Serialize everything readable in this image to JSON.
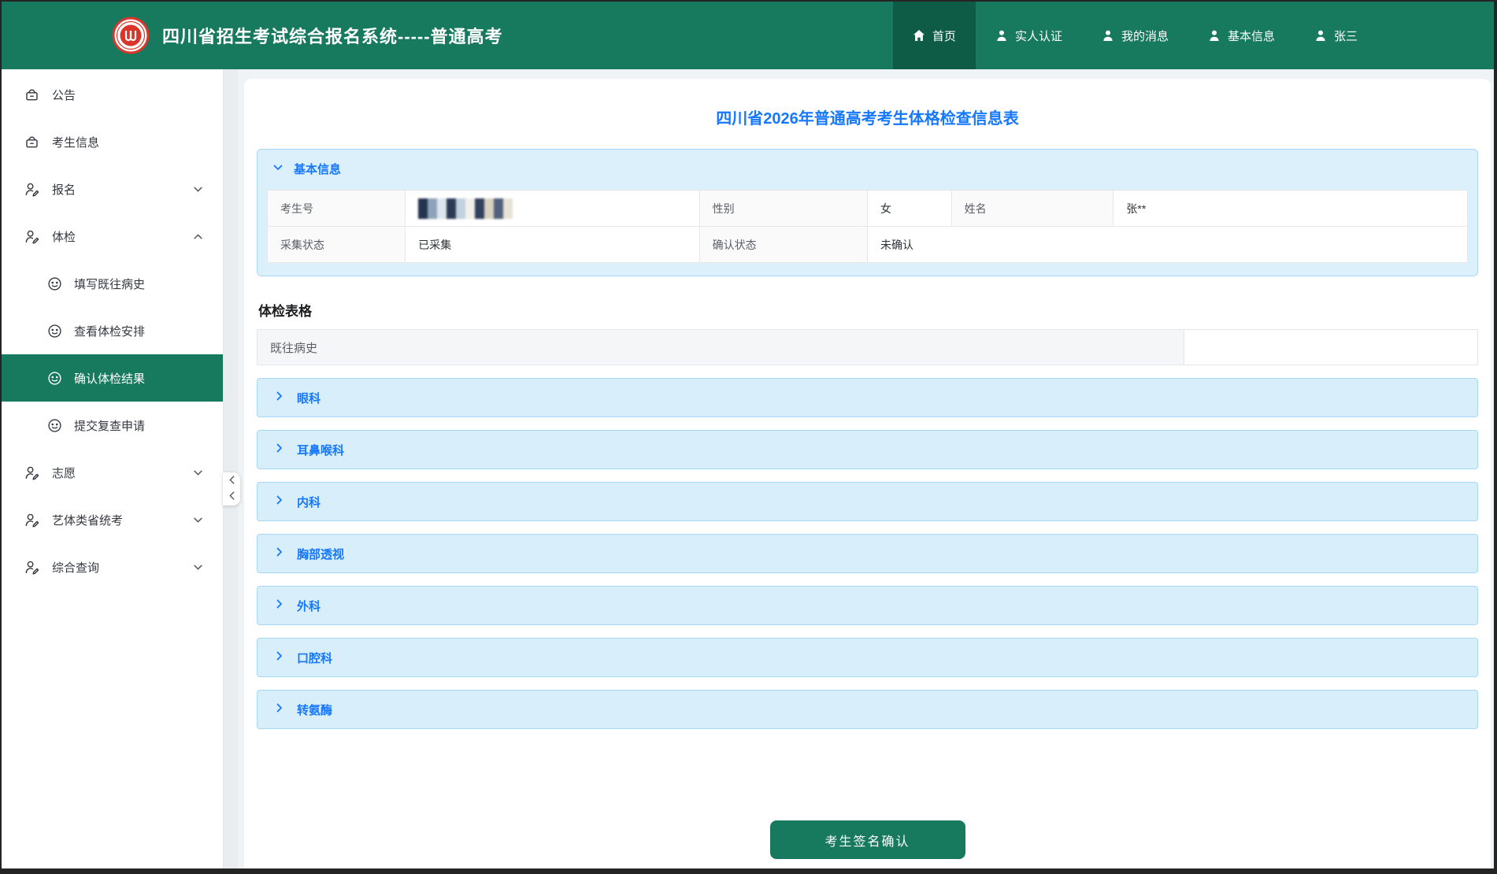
{
  "header": {
    "title": "四川省招生考试综合报名系统-----普通高考",
    "colors": {
      "bar": "#177A5F",
      "active_item": "#0E5C46",
      "text": "#FFFFFF",
      "logo_red": "#D9352A"
    },
    "nav_items": [
      {
        "label": "首页",
        "icon": "home-icon",
        "active": true
      },
      {
        "label": "实人认证",
        "icon": "user-icon",
        "active": false
      },
      {
        "label": "我的消息",
        "icon": "user-icon",
        "active": false
      },
      {
        "label": "基本信息",
        "icon": "user-icon",
        "active": false
      },
      {
        "label": "张三",
        "icon": "user-icon",
        "active": false
      }
    ]
  },
  "sidebar": {
    "selected_color": "#177A5F",
    "items": [
      {
        "label": "公告",
        "icon": "archive-box-icon"
      },
      {
        "label": "考生信息",
        "icon": "archive-box-icon"
      },
      {
        "label": "报名",
        "icon": "user-edit-icon",
        "chevron": "down"
      },
      {
        "label": "体检",
        "icon": "user-edit-icon",
        "chevron": "up",
        "expanded": true
      },
      {
        "label": "填写既往病史",
        "icon": "smiley-icon",
        "sub": true
      },
      {
        "label": "查看体检安排",
        "icon": "smiley-icon",
        "sub": true
      },
      {
        "label": "确认体检结果",
        "icon": "smiley-icon",
        "sub": true,
        "selected": true
      },
      {
        "label": "提交复查申请",
        "icon": "smiley-icon",
        "sub": true
      },
      {
        "label": "志愿",
        "icon": "user-edit-icon",
        "chevron": "down"
      },
      {
        "label": "艺体类省统考",
        "icon": "user-edit-icon",
        "chevron": "down"
      },
      {
        "label": "综合查询",
        "icon": "user-edit-icon",
        "chevron": "down"
      }
    ]
  },
  "main": {
    "accent_blue": "#1677FF",
    "page_title": "四川省2026年普通高考考生体格检查信息表",
    "basic_info": {
      "header_label": "基本信息",
      "row1": {
        "exam_no_label": "考生号",
        "gender_label": "性别",
        "gender_value": "女",
        "name_label": "姓名",
        "name_value": "张**"
      },
      "row2": {
        "collect_label": "采集状态",
        "collect_value": "已采集",
        "confirm_label": "确认状态",
        "confirm_value": "未确认"
      },
      "masked_value_colors": [
        "#24344F",
        "#8EA2B7",
        "#DDE6EE",
        "#2C3B56",
        "#C2D1DE",
        "#F2F0EA",
        "#32415D",
        "#D8D2C2",
        "#51617A",
        "#E7E2D6"
      ]
    },
    "exam_form": {
      "heading": "体检表格",
      "history_label": "既往病史",
      "sections": [
        {
          "label": "眼科"
        },
        {
          "label": "耳鼻喉科"
        },
        {
          "label": "内科"
        },
        {
          "label": "胸部透视"
        },
        {
          "label": "外科"
        },
        {
          "label": "口腔科"
        },
        {
          "label": "转氨酶"
        }
      ]
    },
    "confirm_button_label": "考生签名确认"
  }
}
